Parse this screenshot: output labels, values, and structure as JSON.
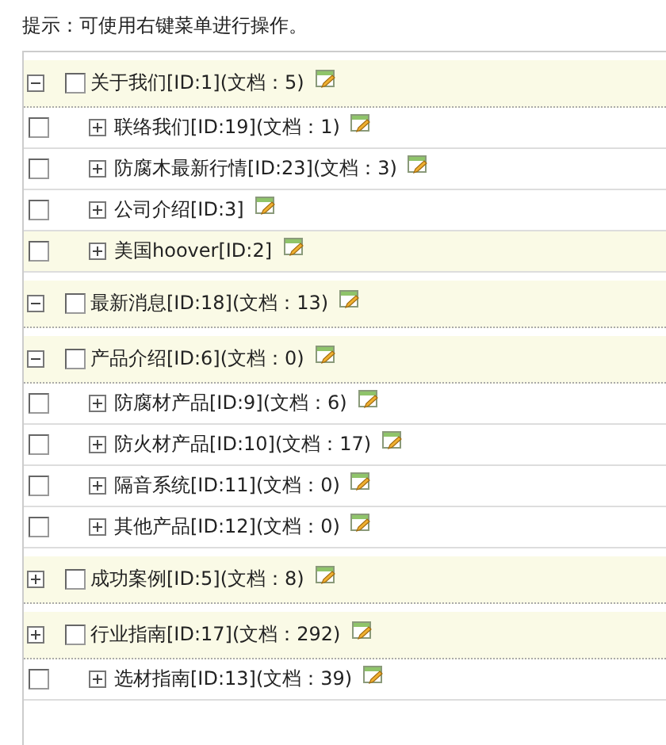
{
  "hint": "提示：可使用右键菜单进行操作。",
  "categories": [
    {
      "label": "关于我们[ID:1](文档：5)",
      "expanded": true,
      "checked": false,
      "children": [
        {
          "label": "联络我们[ID:19](文档：1)",
          "checked": false,
          "hovered": false
        },
        {
          "label": "防腐木最新行情[ID:23](文档：3)",
          "checked": false,
          "hovered": false
        },
        {
          "label": "公司介绍[ID:3]",
          "checked": false,
          "hovered": false
        },
        {
          "label": "美国hoover[ID:2]",
          "checked": false,
          "hovered": true
        }
      ]
    },
    {
      "label": "最新消息[ID:18](文档：13)",
      "expanded": true,
      "checked": false
    },
    {
      "label": "产品介绍[ID:6](文档：0)",
      "expanded": true,
      "checked": false,
      "children": [
        {
          "label": "防腐材产品[ID:9](文档：6)",
          "checked": false,
          "hovered": false
        },
        {
          "label": "防火材产品[ID:10](文档：17)",
          "checked": false,
          "hovered": false
        },
        {
          "label": "隔音系统[ID:11](文档：0)",
          "checked": false,
          "hovered": false
        },
        {
          "label": "其他产品[ID:12](文档：0)",
          "checked": false,
          "hovered": false
        }
      ]
    },
    {
      "label": "成功案例[ID:5](文档：8)",
      "expanded": false,
      "checked": false
    },
    {
      "label": "行业指南[ID:17](文档：292)",
      "expanded": false,
      "checked": false,
      "children": [
        {
          "label": "选材指南[ID:13](文档：39)",
          "checked": false,
          "hovered": false
        }
      ]
    }
  ]
}
